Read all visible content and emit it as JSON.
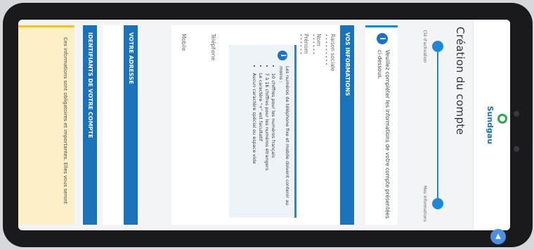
{
  "app": {
    "logo_text": "Sundgau"
  },
  "page": {
    "title": "Création du compte"
  },
  "stepper": {
    "steps": [
      {
        "label": "Clé d'activation"
      },
      {
        "label": "Mes informations"
      }
    ]
  },
  "info": {
    "icon": "info-icon",
    "text": "Veuillez compléter les informations de votre compte présentées ci-dessous."
  },
  "vos_informations": {
    "header": "VOS INFORMATIONS",
    "fields": [
      {
        "label": "Raison sociale",
        "value": "•••••••••"
      },
      {
        "label": "Nom",
        "value": "••••••"
      },
      {
        "label": "Prénom",
        "value": "••••••"
      }
    ]
  },
  "contact": {
    "telephone_label": "Téléphone",
    "mobile_label": "Mobile",
    "tel_info": {
      "intro": "Les numéros de téléphone fixe et mobile doivent contenir au moins :",
      "rules": [
        "10 chiffres pour les numéros français",
        "7 à 16 chiffres pour les numéros étrangers",
        "Le caractère \"+\" est facultatif",
        "Aucun caractère spécial ou espace vide"
      ]
    }
  },
  "votre_adresse": {
    "header": "VOTRE ADRESSE"
  },
  "identifiants": {
    "header": "IDENTIFIANTS DE VOTRE COMPTE"
  },
  "note": {
    "text": "Ces informations sont obligatoires et importantes. Elles vous seront"
  },
  "colors": {
    "primary": "#1a73b8",
    "accent": "#1e88d8",
    "logo_green": "#2aa84a",
    "note_bg": "#fdf0c8"
  }
}
